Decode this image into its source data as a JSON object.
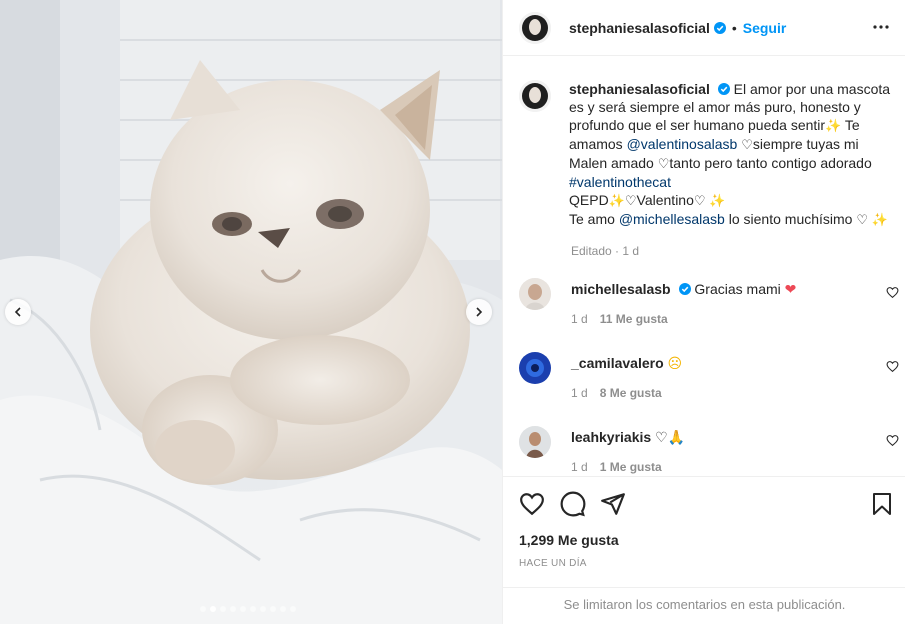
{
  "post": {
    "author": "stephaniesalasoficial",
    "follow_label": "Seguir",
    "separator": "•"
  },
  "caption": {
    "author": "stephaniesalasoficial",
    "text_1": "El amor por una mascota es y será siempre el amor más puro, honesto y profundo que el ser humano pueda sentir",
    "text_2": "Te amamos",
    "mention_1": "@valentinosalasb",
    "text_3": "siempre tuyas mi Malen amado",
    "text_4": "tanto pero tanto contigo adorado",
    "hashtag": "#valentinothecat",
    "text_5": "QEPD",
    "text_6": "Valentino",
    "text_7": "Te amo",
    "mention_2": "@michellesalasb",
    "text_8": "lo siento muchísimo",
    "meta": "Editado · 1 d"
  },
  "comments": [
    {
      "user": "michellesalasb",
      "text": "Gracias mami",
      "time": "1 d",
      "likes": "11 Me gusta"
    },
    {
      "user": "_camilavalero",
      "text": "",
      "time": "1 d",
      "likes": "8 Me gusta"
    },
    {
      "user": "leahkyriakis",
      "text": "",
      "time": "1 d",
      "likes": "1 Me gusta"
    }
  ],
  "footer": {
    "likes": "1,299 Me gusta",
    "date": "HACE UN DÍA",
    "comments_limited": "Se limitaron los comentarios en esta publicación."
  },
  "carousel": {
    "total": 10,
    "active_index": 1
  },
  "colors": {
    "accent": "#0095f6",
    "link": "#00376b",
    "muted": "#8e8e8e",
    "heart_red": "#ed4956"
  }
}
